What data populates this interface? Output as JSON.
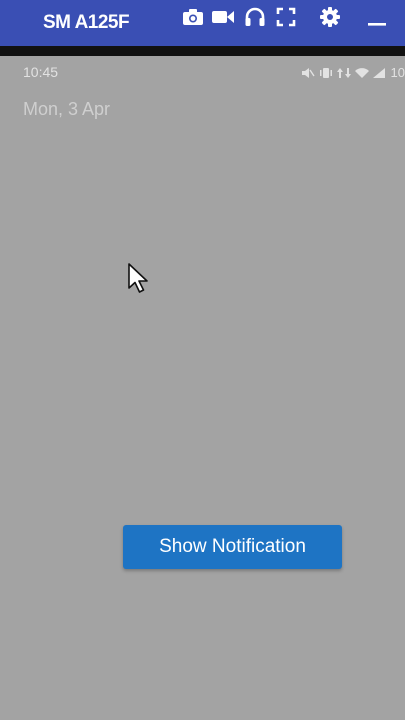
{
  "toolbar": {
    "device_name": "SM A125F",
    "icons": [
      "camera-icon",
      "video-icon",
      "headphones-icon",
      "fullscreen-icon",
      "gear-icon",
      "minimize-icon"
    ],
    "background_color": "#3a4fb4"
  },
  "status_bar": {
    "time": "10:45",
    "battery": "10",
    "icons": [
      "mute-icon",
      "vibrate-icon",
      "data-icon",
      "wifi-icon",
      "signal-icon"
    ]
  },
  "lock_screen": {
    "date": "Mon, 3 Apr"
  },
  "main": {
    "button_label": "Show Notification",
    "button_color": "#1e74c4"
  }
}
